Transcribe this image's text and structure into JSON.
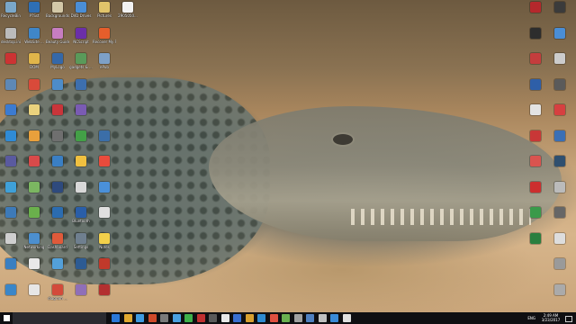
{
  "desktop": {
    "left_icons": [
      {
        "label": "RecycleBin",
        "color": "#7aa7c9",
        "col": 0,
        "row": 0
      },
      {
        "label": "PTSst",
        "color": "#2e6fb5",
        "col": 1,
        "row": 0
      },
      {
        "label": "Backgrounds",
        "color": "#d3c8a8",
        "col": 2,
        "row": 0
      },
      {
        "label": "DVD Drives",
        "color": "#4a8ed6",
        "col": 3,
        "row": 0
      },
      {
        "label": "Pictures",
        "color": "#e1c46a",
        "col": 4,
        "row": 0
      },
      {
        "label": "2905050...",
        "color": "#f2f2f2",
        "col": 5,
        "row": 0
      },
      {
        "label": "desktop.ini",
        "color": "#bbbbbb",
        "col": 0,
        "row": 1
      },
      {
        "label": "WebSite ...",
        "color": "#3f86c8",
        "col": 1,
        "row": 1
      },
      {
        "label": "Beauty Guide",
        "color": "#c77dc1",
        "col": 2,
        "row": 1
      },
      {
        "label": "NCScript",
        "color": "#6b2fa8",
        "col": 3,
        "row": 1
      },
      {
        "label": "Recover My Files v2",
        "color": "#e65e2b",
        "col": 4,
        "row": 1
      },
      {
        "label": "",
        "color": "#c33",
        "col": 0,
        "row": 2
      },
      {
        "label": "DOM",
        "color": "#e0b54a",
        "col": 1,
        "row": 2
      },
      {
        "label": "MyLogo",
        "color": "#3568a8",
        "col": 2,
        "row": 2
      },
      {
        "label": "gadgets & ...",
        "color": "#5a9a5a",
        "col": 3,
        "row": 2
      },
      {
        "label": "ePub",
        "color": "#7da0c7",
        "col": 4,
        "row": 2
      },
      {
        "label": "",
        "color": "#5e88b5",
        "col": 0,
        "row": 3
      },
      {
        "label": "",
        "color": "#d94a3a",
        "col": 1,
        "row": 3
      },
      {
        "label": "",
        "color": "#4d8cc9",
        "col": 2,
        "row": 3
      },
      {
        "label": "",
        "color": "#3d6fae",
        "col": 3,
        "row": 3
      },
      {
        "label": "",
        "color": "#3c7bd1",
        "col": 0,
        "row": 4
      },
      {
        "label": "",
        "color": "#ead27d",
        "col": 1,
        "row": 4
      },
      {
        "label": "",
        "color": "#c9353a",
        "col": 2,
        "row": 4
      },
      {
        "label": "",
        "color": "#7a5bb3",
        "col": 3,
        "row": 4
      },
      {
        "label": "",
        "color": "#2f8bd6",
        "col": 0,
        "row": 5
      },
      {
        "label": "",
        "color": "#e8a03c",
        "col": 1,
        "row": 5
      },
      {
        "label": "",
        "color": "#6f6f6f",
        "col": 2,
        "row": 5
      },
      {
        "label": "",
        "color": "#43a047",
        "col": 3,
        "row": 5
      },
      {
        "label": "",
        "color": "#3b6ea8",
        "col": 4,
        "row": 5
      },
      {
        "label": "",
        "color": "#5a5a9f",
        "col": 0,
        "row": 6
      },
      {
        "label": "",
        "color": "#d84a4a",
        "col": 1,
        "row": 6
      },
      {
        "label": "",
        "color": "#3a7fc4",
        "col": 2,
        "row": 6
      },
      {
        "label": "",
        "color": "#f0c040",
        "col": 3,
        "row": 6
      },
      {
        "label": "",
        "color": "#e94b3c",
        "col": 4,
        "row": 6
      },
      {
        "label": "",
        "color": "#3fa0d8",
        "col": 0,
        "row": 7
      },
      {
        "label": "",
        "color": "#7bb661",
        "col": 1,
        "row": 7
      },
      {
        "label": "",
        "color": "#2e4a7d",
        "col": 2,
        "row": 7
      },
      {
        "label": "",
        "color": "#d8d8d8",
        "col": 3,
        "row": 7
      },
      {
        "label": "",
        "color": "#4a90d9",
        "col": 4,
        "row": 7
      },
      {
        "label": "",
        "color": "#3d7ab8",
        "col": 0,
        "row": 8
      },
      {
        "label": "",
        "color": "#6ab04c",
        "col": 1,
        "row": 8
      },
      {
        "label": "",
        "color": "#2b6cb0",
        "col": 2,
        "row": 8
      },
      {
        "label": "Bluetooth",
        "color": "#2a5ea8",
        "col": 3,
        "row": 8
      },
      {
        "label": "",
        "color": "#e0e0e0",
        "col": 4,
        "row": 8
      },
      {
        "label": "",
        "color": "#cfcfcf",
        "col": 0,
        "row": 9
      },
      {
        "label": "Networking",
        "color": "#4c8fcf",
        "col": 1,
        "row": 9
      },
      {
        "label": "Dashboard",
        "color": "#e05a3a",
        "col": 2,
        "row": 9
      },
      {
        "label": "Settings",
        "color": "#6f7f8f",
        "col": 3,
        "row": 9
      },
      {
        "label": "Notes",
        "color": "#f2d04a",
        "col": 4,
        "row": 9
      },
      {
        "label": "",
        "color": "#3b7fc1",
        "col": 0,
        "row": 10
      },
      {
        "label": "",
        "color": "#e8e8e8",
        "col": 1,
        "row": 10
      },
      {
        "label": "",
        "color": "#53a0d9",
        "col": 2,
        "row": 10
      },
      {
        "label": "",
        "color": "#2d5b93",
        "col": 3,
        "row": 10
      },
      {
        "label": "",
        "color": "#c0392b",
        "col": 4,
        "row": 10
      },
      {
        "label": "",
        "color": "#3a86c8",
        "col": 0,
        "row": 11
      },
      {
        "label": "",
        "color": "#e6e6e6",
        "col": 1,
        "row": 11
      },
      {
        "label": "diagram ...",
        "color": "#d34a3a",
        "col": 2,
        "row": 11
      },
      {
        "label": "",
        "color": "#8f6fb8",
        "col": 3,
        "row": 11
      },
      {
        "label": "",
        "color": "#b33030",
        "col": 4,
        "row": 11
      }
    ],
    "right_icons": [
      {
        "label": "",
        "color": "#b5282c",
        "col": 0,
        "row": 0
      },
      {
        "label": "",
        "color": "#3b3b3b",
        "col": 1,
        "row": 0
      },
      {
        "label": "",
        "color": "#2d2d2d",
        "col": 0,
        "row": 1
      },
      {
        "label": "",
        "color": "#4a8ed6",
        "col": 1,
        "row": 1
      },
      {
        "label": "",
        "color": "#c43d3d",
        "col": 0,
        "row": 2
      },
      {
        "label": "",
        "color": "#cccccc",
        "col": 1,
        "row": 2
      },
      {
        "label": "",
        "color": "#2e5fa8",
        "col": 0,
        "row": 3
      },
      {
        "label": "",
        "color": "#5a5a5a",
        "col": 1,
        "row": 3
      },
      {
        "label": "",
        "color": "#e3e3e3",
        "col": 0,
        "row": 4
      },
      {
        "label": "",
        "color": "#d64040",
        "col": 1,
        "row": 4
      },
      {
        "label": "",
        "color": "#c83737",
        "col": 0,
        "row": 5
      },
      {
        "label": "",
        "color": "#3a6fb5",
        "col": 1,
        "row": 5
      },
      {
        "label": "",
        "color": "#d9534f",
        "col": 0,
        "row": 6
      },
      {
        "label": "",
        "color": "#2f4f6f",
        "col": 1,
        "row": 6
      },
      {
        "label": "",
        "color": "#cc2e2e",
        "col": 0,
        "row": 7
      },
      {
        "label": "",
        "color": "#bbbbbb",
        "col": 1,
        "row": 7
      },
      {
        "label": "",
        "color": "#3a9a4a",
        "col": 0,
        "row": 8
      },
      {
        "label": "",
        "color": "#666666",
        "col": 1,
        "row": 8
      },
      {
        "label": "",
        "color": "#2a7f3f",
        "col": 0,
        "row": 9
      },
      {
        "label": "",
        "color": "#dddddd",
        "col": 1,
        "row": 9
      },
      {
        "label": "",
        "color": "#9a9a9a",
        "col": 1,
        "row": 10
      },
      {
        "label": "",
        "color": "#aaaaaa",
        "col": 1,
        "row": 11
      }
    ]
  },
  "taskbar": {
    "apps": [
      "#2b78d8",
      "#e0a830",
      "#3f9ae0",
      "#d04a2a",
      "#7a7a7a",
      "#4aa0e0",
      "#3fb04a",
      "#c03030",
      "#5a5a5a",
      "#e8e8e8",
      "#3a6fd0",
      "#d8a030",
      "#2f8ad0",
      "#e05040",
      "#6ab050",
      "#a0a0a0",
      "#5080c0",
      "#c0c0c0",
      "#3a8ad6",
      "#e0e0e0"
    ],
    "tray_lang": "ENG",
    "time": "2:49 AM",
    "date": "3/23/2017"
  }
}
